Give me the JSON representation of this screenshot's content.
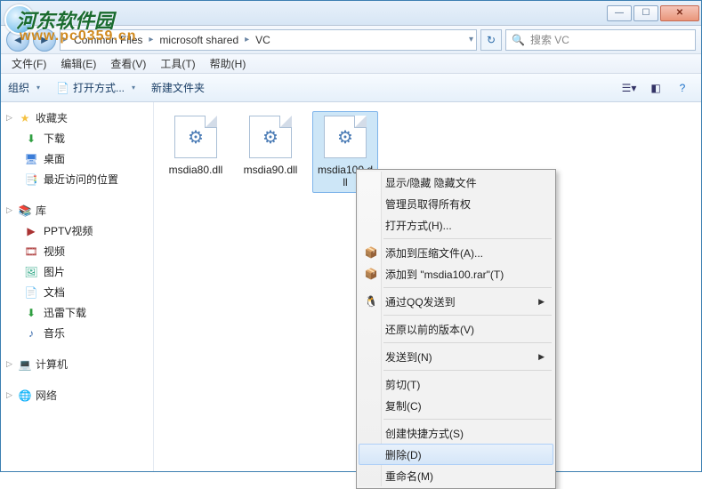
{
  "breadcrumb": {
    "seg1": "Common Files",
    "seg2": "microsoft shared",
    "seg3": "VC"
  },
  "search": {
    "placeholder": "搜索 VC"
  },
  "menubar": {
    "file": "文件(F)",
    "edit": "编辑(E)",
    "view": "查看(V)",
    "tools": "工具(T)",
    "help": "帮助(H)"
  },
  "toolbar": {
    "organize": "组织",
    "openwith": "打开方式...",
    "newfolder": "新建文件夹"
  },
  "sidebar": {
    "favorites": {
      "label": "收藏夹",
      "items": [
        "下载",
        "桌面",
        "最近访问的位置"
      ]
    },
    "libraries": {
      "label": "库",
      "items": [
        "PPTV视频",
        "视频",
        "图片",
        "文档",
        "迅雷下载",
        "音乐"
      ]
    },
    "computer": {
      "label": "计算机"
    },
    "network": {
      "label": "网络"
    }
  },
  "files": [
    {
      "name": "msdia80.dll"
    },
    {
      "name": "msdia90.dll"
    },
    {
      "name": "msdia100.dll"
    }
  ],
  "context": {
    "show_hidden": "显示/隐藏 隐藏文件",
    "admin_rights": "管理员取得所有权",
    "open_with": "打开方式(H)...",
    "add_archive": "添加到压缩文件(A)...",
    "add_to_rar": "添加到 \"msdia100.rar\"(T)",
    "qq_send": "通过QQ发送到",
    "restore_prev": "还原以前的版本(V)",
    "send_to": "发送到(N)",
    "cut": "剪切(T)",
    "copy": "复制(C)",
    "create_shortcut": "创建快捷方式(S)",
    "delete": "删除(D)",
    "rename": "重命名(M)"
  },
  "watermark": {
    "a": "河东软件园",
    "b": "www.pc0359.cn"
  }
}
